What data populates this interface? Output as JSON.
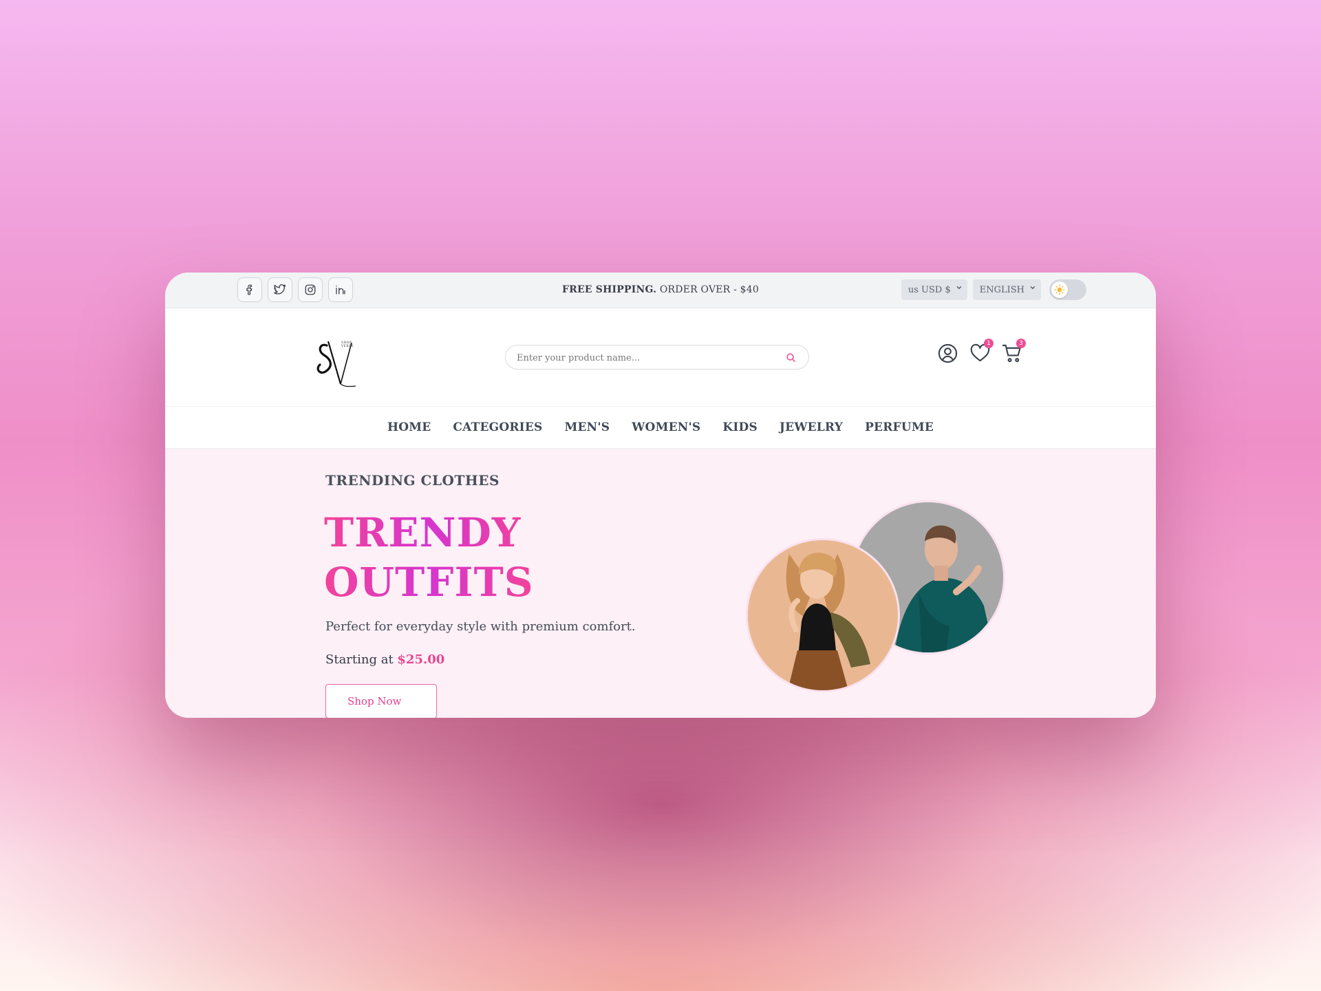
{
  "topbar": {
    "promo_bold": "FREE SHIPPING.",
    "promo_rest": " ORDER OVER - $40",
    "currency": "us USD $",
    "language": "ENGLISH"
  },
  "search": {
    "placeholder": "Enter your product name..."
  },
  "header": {
    "wishlist_count": "1",
    "cart_count": "3"
  },
  "nav": {
    "items": [
      "HOME",
      "CATEGORIES",
      "MEN'S",
      "WOMEN'S",
      "KIDS",
      "JEWELRY",
      "PERFUME"
    ]
  },
  "hero": {
    "eyebrow": "TRENDING CLOTHES",
    "headline_line1": "TRENDY",
    "headline_line2": "OUTFITS",
    "description": "Perfect for everyday style with premium comfort.",
    "price_prefix": "Starting at ",
    "price": "$25.00",
    "cta": "Shop Now"
  },
  "colors": {
    "accent": "#ec4f96",
    "headline_gradient": [
      "#f2439a",
      "#d535cf"
    ],
    "nav_text": "#414a57"
  },
  "icons": [
    "facebook-icon",
    "twitter-icon",
    "instagram-icon",
    "linkedin-icon",
    "sun-icon",
    "search-icon",
    "user-icon",
    "heart-icon",
    "cart-icon"
  ]
}
